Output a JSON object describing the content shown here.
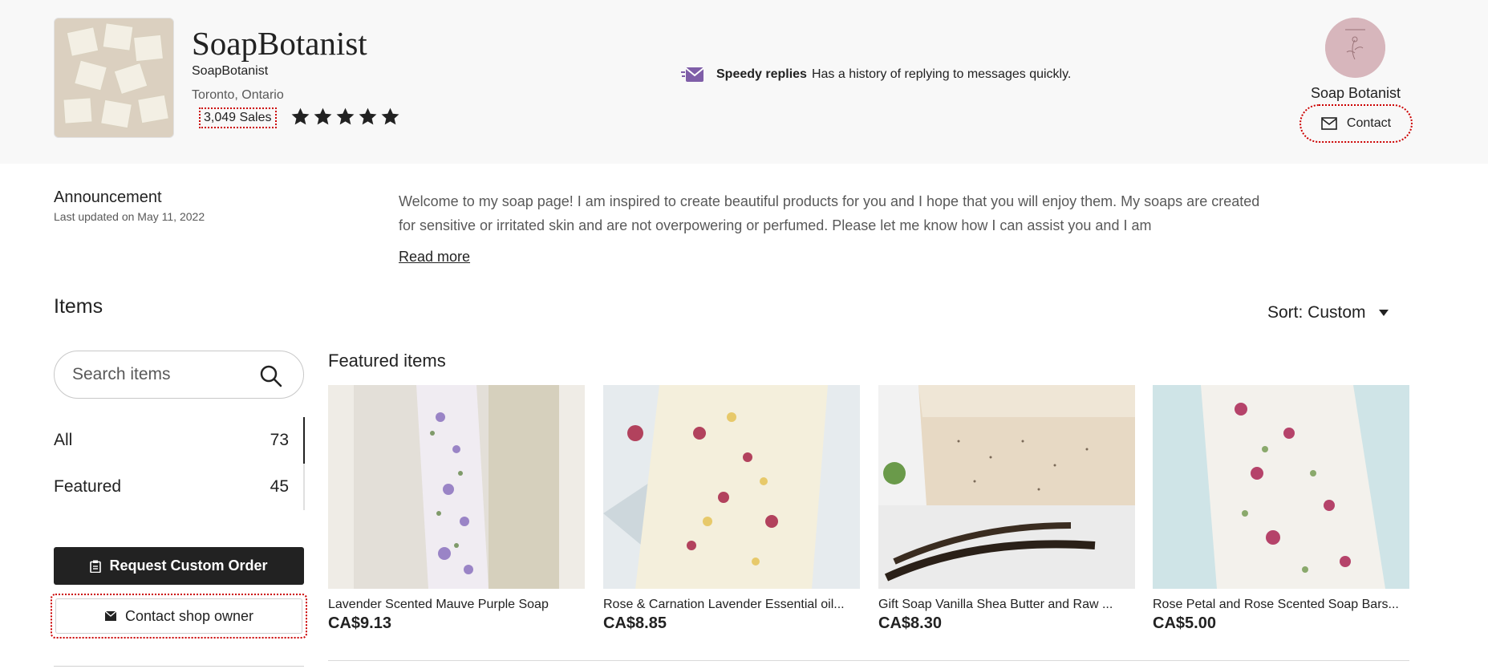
{
  "shop": {
    "name": "SoapBotanist",
    "handle": "SoapBotanist",
    "location": "Toronto, Ontario",
    "sales": "3,049 Sales",
    "rating_stars": 5
  },
  "speedy": {
    "title": "Speedy replies",
    "description": "Has a history of replying to messages quickly."
  },
  "owner": {
    "name": "Soap Botanist",
    "contact_label": "Contact"
  },
  "announcement": {
    "title": "Announcement",
    "updated": "Last updated on May 11, 2022",
    "text": "Welcome to my soap page! I am inspired to create beautiful products for you and I hope that you will enjoy them. My soaps are created for sensitive or irritated skin and are not overpowering or perfumed. Please let me know how I can assist you and I am",
    "read_more": "Read more"
  },
  "sidebar": {
    "items_title": "Items",
    "search_placeholder": "Search items",
    "categories": [
      {
        "label": "All",
        "count": "73"
      },
      {
        "label": "Featured",
        "count": "45"
      }
    ],
    "request_custom_order": "Request Custom Order",
    "contact_shop_owner": "Contact shop owner"
  },
  "sort": {
    "label": "Sort: Custom"
  },
  "featured": {
    "title": "Featured items",
    "items": [
      {
        "title": "Lavender Scented Mauve Purple Soap",
        "price": "CA$9.13"
      },
      {
        "title": "Rose & Carnation Lavender Essential oil...",
        "price": "CA$8.85"
      },
      {
        "title": "Gift Soap Vanilla Shea Butter and Raw ...",
        "price": "CA$8.30"
      },
      {
        "title": "Rose Petal and Rose Scented Soap Bars...",
        "price": "CA$5.00"
      }
    ]
  },
  "colors": {
    "header_bg": "#f8f8f8",
    "speedy_purple": "#7f5ea8",
    "primary_button": "#222222",
    "focus_ring": "#cc0000",
    "avatar_pink": "#d7b6bc"
  }
}
